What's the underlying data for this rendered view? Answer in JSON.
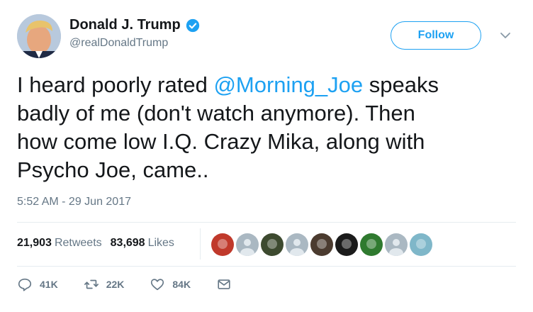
{
  "author": {
    "name": "Donald J. Trump",
    "handle": "@realDonaldTrump"
  },
  "header": {
    "follow_label": "Follow"
  },
  "tweet": {
    "text_before": "I heard poorly rated ",
    "mention": "@Morning_Joe",
    "text_after": " speaks\nbadly of me (don't watch anymore). Then\nhow come low I.Q. Crazy Mika, along with\nPsycho Joe, came..",
    "timestamp": "5:52 AM - 29 Jun 2017"
  },
  "stats": {
    "retweets_count": "21,903",
    "retweets_label": "Retweets",
    "likes_count": "83,698",
    "likes_label": "Likes"
  },
  "likers": [
    {
      "name": "liker-avatar-1",
      "color": "#c0392b"
    },
    {
      "name": "liker-avatar-2",
      "color": "#aab8c2"
    },
    {
      "name": "liker-avatar-3",
      "color": "#3d4a2f"
    },
    {
      "name": "liker-avatar-4",
      "color": "#aab8c2"
    },
    {
      "name": "liker-avatar-5",
      "color": "#4b3b2f"
    },
    {
      "name": "liker-avatar-6",
      "color": "#1b1b1b"
    },
    {
      "name": "liker-avatar-7",
      "color": "#2f7a2f"
    },
    {
      "name": "liker-avatar-8",
      "color": "#aab8c2"
    },
    {
      "name": "liker-avatar-9",
      "color": "#7fb7c9"
    }
  ],
  "actions": {
    "replies": "41K",
    "retweets": "22K",
    "likes": "84K"
  },
  "colors": {
    "accent": "#1da1f2",
    "secondary_text": "#657786",
    "divider": "#e6ecf0"
  }
}
